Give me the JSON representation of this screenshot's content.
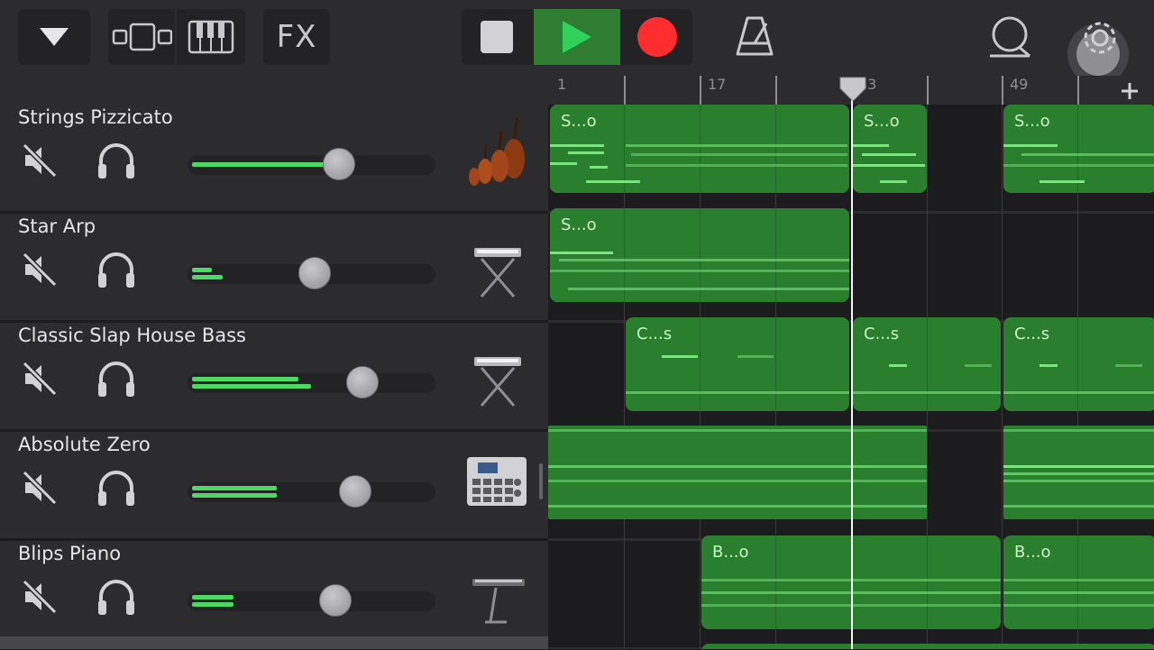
{
  "toolbar": {
    "fx_label": "FX",
    "colors": {
      "play_active": "#2e7d32",
      "play_icon": "#30d158",
      "record": "#ff2d2d"
    }
  },
  "ruler": {
    "labels": [
      "1",
      "17",
      "33",
      "49"
    ]
  },
  "tracks": [
    {
      "name": "Strings Pizzicato",
      "instrument_icon": "violin-cello-icon",
      "volume": 0.6
    },
    {
      "name": "Star Arp",
      "instrument_icon": "keyboard-stand-icon",
      "volume": 0.5
    },
    {
      "name": "Classic Slap House Bass",
      "instrument_icon": "keyboard-stand-icon",
      "volume": 0.71
    },
    {
      "name": "Absolute Zero",
      "instrument_icon": "drum-machine-icon",
      "volume": 0.68
    },
    {
      "name": "Blips Piano",
      "instrument_icon": "keyboard-stand-icon",
      "volume": 0.6
    }
  ],
  "regions": [
    {
      "label": "S...o",
      "track": 0
    },
    {
      "label": "S...o",
      "track": 0
    },
    {
      "label": "S...o",
      "track": 0
    },
    {
      "label": "S...o",
      "track": 1
    },
    {
      "label": "C...s",
      "track": 2
    },
    {
      "label": "C...s",
      "track": 2
    },
    {
      "label": "C...s",
      "track": 2
    },
    {
      "label": "",
      "track": 3
    },
    {
      "label": "",
      "track": 3
    },
    {
      "label": "B...o",
      "track": 4
    },
    {
      "label": "B...o",
      "track": 4
    }
  ]
}
